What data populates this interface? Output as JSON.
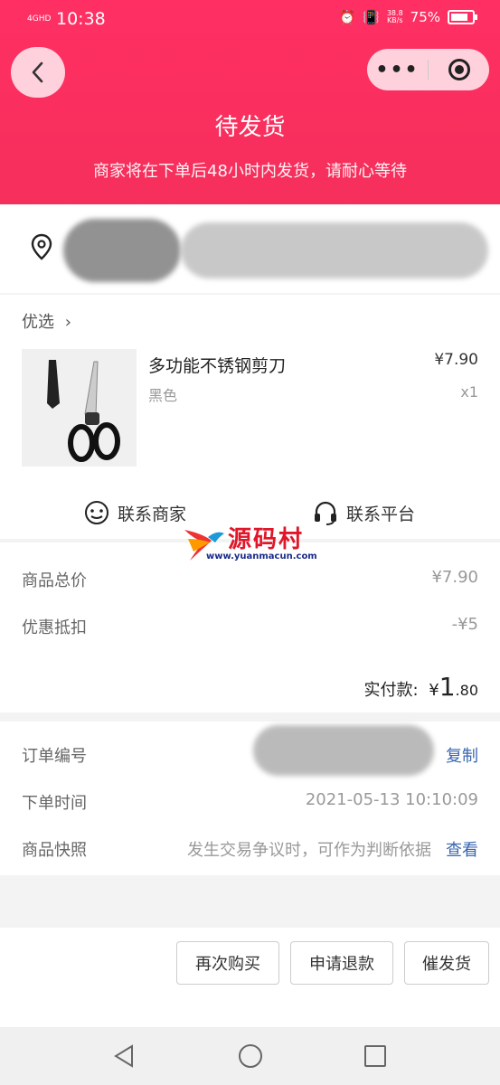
{
  "status_bar": {
    "network": "4GHD",
    "time": "10:38",
    "speed_value": "38.8",
    "speed_unit": "KB/s",
    "battery": "75%"
  },
  "header": {
    "title": "待发货",
    "subtitle": "商家将在下单后48小时内发货，请耐心等待"
  },
  "product": {
    "shop_name": "优选",
    "name": "多功能不锈钢剪刀",
    "variant": "黑色",
    "price": "¥7.90",
    "quantity": "x1"
  },
  "contacts": {
    "merchant": "联系商家",
    "platform": "联系平台"
  },
  "watermark": {
    "text": "源码村",
    "url": "www.yuanmacun.com"
  },
  "pricing": {
    "total_label": "商品总价",
    "total_value": "¥7.90",
    "discount_label": "优惠抵扣",
    "discount_value": "-¥5",
    "paid_label": "实付款:",
    "paid_currency": "¥",
    "paid_integer": "1",
    "paid_decimal": ".80"
  },
  "order_info": {
    "order_no_label": "订单编号",
    "copy_label": "复制",
    "order_time_label": "下单时间",
    "order_time_value": "2021-05-13 10:10:09",
    "snapshot_label": "商品快照",
    "snapshot_desc": "发生交易争议时，可作为判断依据",
    "snapshot_link": "查看"
  },
  "actions": {
    "rebuy": "再次购买",
    "refund": "申请退款",
    "urge": "催发货"
  },
  "colors": {
    "header": "#f52f5b",
    "link": "#3a66b0"
  }
}
